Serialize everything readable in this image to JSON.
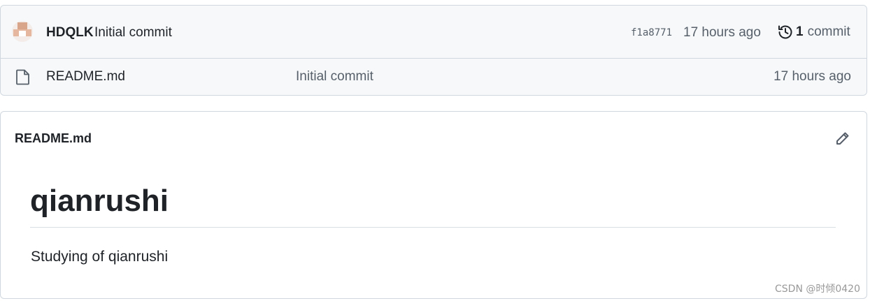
{
  "latest_commit": {
    "author": "HDQLK",
    "message": "Initial commit",
    "sha": "f1a8771",
    "age": "17 hours ago",
    "history_icon": "history-icon",
    "commit_count": "1",
    "commit_word": "commit"
  },
  "files": [
    {
      "icon": "file-icon",
      "name": "README.md",
      "commit_message": "Initial commit",
      "age": "17 hours ago"
    }
  ],
  "readme": {
    "header": "README.md",
    "edit_icon": "pencil-icon",
    "title": "qianrushi",
    "body": "Studying of qianrushi"
  },
  "watermark": "CSDN @时倾0420"
}
